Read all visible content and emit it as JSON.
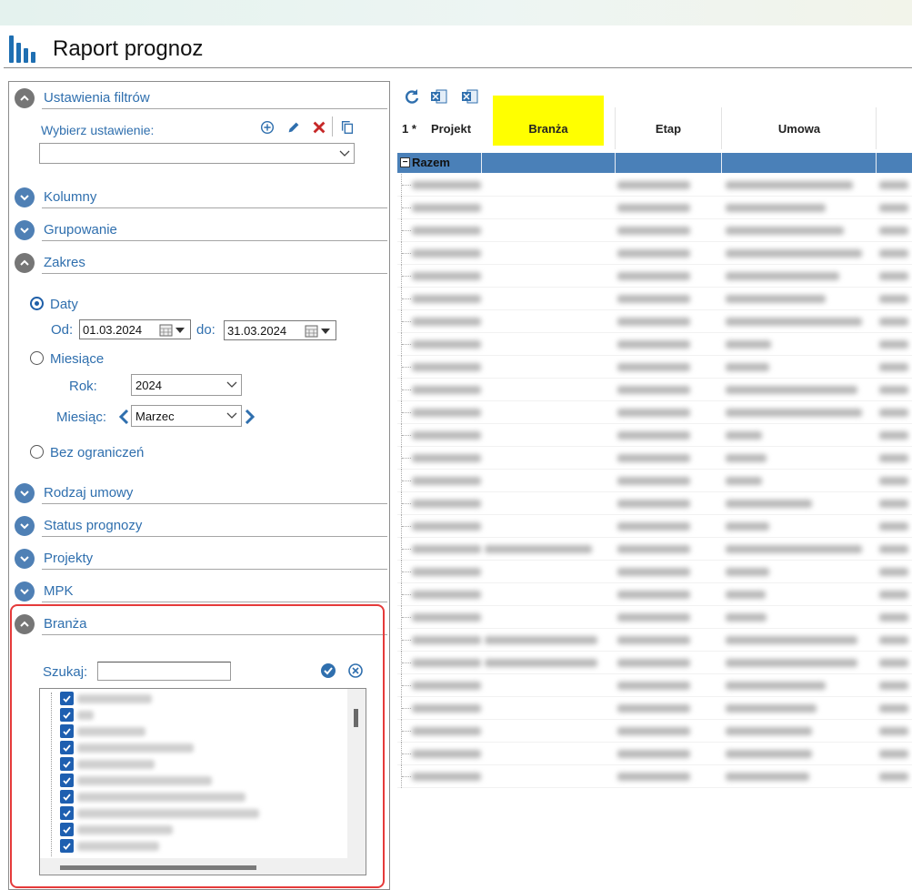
{
  "app": {
    "title": "Raport prognoz"
  },
  "filters": {
    "ustawienia": {
      "label": "Ustawienia filtrów",
      "wybierz_label": "Wybierz ustawienie:",
      "selected_value": ""
    },
    "sections": {
      "kolumny": "Kolumny",
      "grupowanie": "Grupowanie",
      "zakres": "Zakres",
      "rodzaj_umowy": "Rodzaj umowy",
      "status_prognozy": "Status prognozy",
      "projekty": "Projekty",
      "mpk": "MPK",
      "branza": "Branża"
    },
    "zakres": {
      "daty_label": "Daty",
      "od_label": "Od:",
      "od_value": "01.03.2024",
      "do_label": "do:",
      "do_value": "31.03.2024",
      "miesiace_label": "Miesiące",
      "rok_label": "Rok:",
      "rok_value": "2024",
      "miesiac_label": "Miesiąc:",
      "miesiac_value": "Marzec",
      "bez_label": "Bez ograniczeń",
      "selected": "daty"
    },
    "branza": {
      "szukaj_label": "Szukaj:",
      "szukaj_value": "",
      "items_checked": 10
    }
  },
  "grid": {
    "row_count_label": "1 *",
    "columns": {
      "projekt": "Projekt",
      "branza": "Branża",
      "etap": "Etap",
      "umowa": "Umowa"
    },
    "group_row": {
      "label": "Razem",
      "expander": "−"
    },
    "highlight_color": "#ffff00"
  },
  "colors": {
    "accent": "#2f6fae",
    "group_row": "#4a80b8",
    "highlight_border": "#e53a3a",
    "close_red": "#c62828"
  }
}
